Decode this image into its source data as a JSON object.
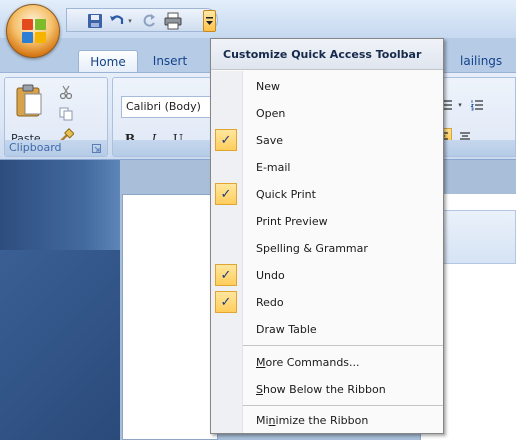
{
  "tabs": {
    "home": "Home",
    "insert": "Insert"
  },
  "ribbon": {
    "paste_label": "Paste",
    "font_name": "Calibri (Body)",
    "bold": "B",
    "italic": "I",
    "underline": "U",
    "clipboard_label": "Clipboard"
  },
  "menu": {
    "header": "Customize Quick Access Toolbar",
    "behind_tab_fragment": "lailings",
    "items": [
      {
        "label": "New",
        "checked": false
      },
      {
        "label": "Open",
        "checked": false
      },
      {
        "label": "Save",
        "checked": true
      },
      {
        "label": "E-mail",
        "checked": false
      },
      {
        "label": "Quick Print",
        "checked": true
      },
      {
        "label": "Print Preview",
        "checked": false
      },
      {
        "label": "Spelling & Grammar",
        "checked": false
      },
      {
        "label": "Undo",
        "checked": true
      },
      {
        "label": "Redo",
        "checked": true
      },
      {
        "label": "Draw Table",
        "checked": false
      }
    ],
    "more_commands": {
      "mnemonic": "M",
      "rest": "ore Commands..."
    },
    "show_below": {
      "mnemonic": "S",
      "rest": "how Below the Ribbon"
    },
    "minimize": {
      "pre": "Mi",
      "mnemonic": "n",
      "rest": "imize the Ribbon"
    },
    "check_glyph": "✓",
    "accent_color": "#ffcd5b"
  },
  "icons": [
    "office-button-icon",
    "save-icon",
    "undo-icon",
    "redo-icon",
    "quick-print-icon",
    "customize-dropdown-icon",
    "paste-icon",
    "cut-icon",
    "copy-icon",
    "format-painter-icon",
    "dialog-launcher-icon"
  ]
}
